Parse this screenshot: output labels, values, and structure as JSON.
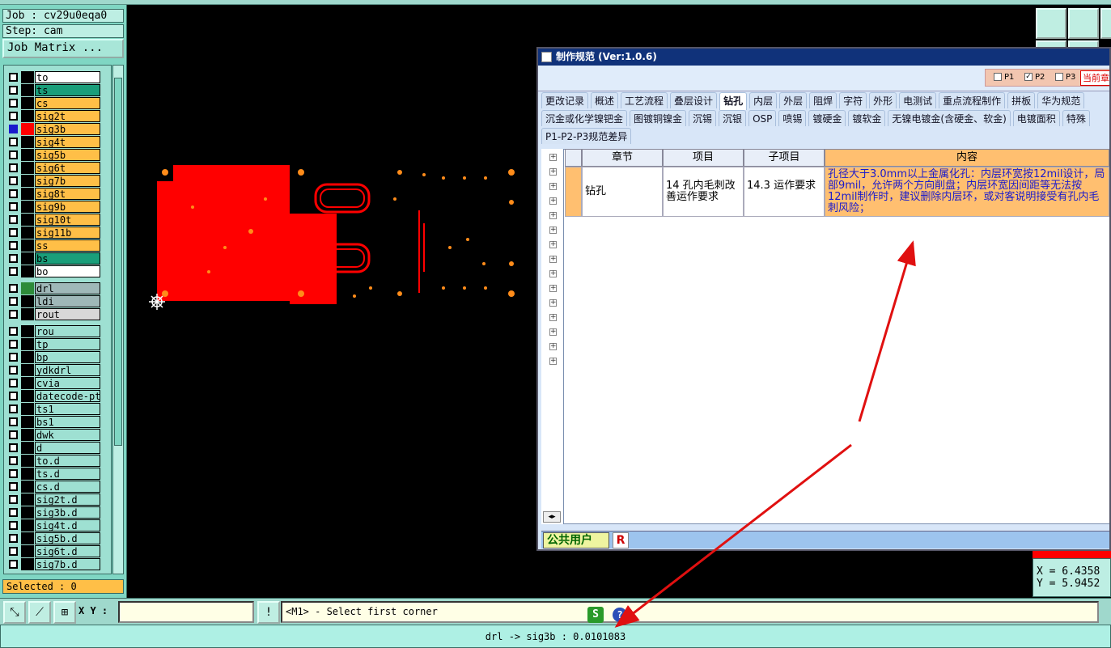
{
  "app": {
    "job_label": "Job : cv29u0eqa0",
    "step_label": "Step: cam",
    "job_matrix_button": "Job Matrix ...",
    "selected_label": "Selected : 0"
  },
  "layers": [
    {
      "name": "to",
      "bg": "#ffffff",
      "sw": "#000000"
    },
    {
      "name": "ts",
      "bg": "#1a9e7a",
      "sw": "#000000"
    },
    {
      "name": "cs",
      "bg": "#ffbf47",
      "sw": "#000000"
    },
    {
      "name": "sig2t",
      "bg": "#ffbf47",
      "sw": "#000000"
    },
    {
      "name": "sig3b",
      "bg": "#ffbf47",
      "sw": "#ff0000",
      "active": true
    },
    {
      "name": "sig4t",
      "bg": "#ffbf47",
      "sw": "#000000"
    },
    {
      "name": "sig5b",
      "bg": "#ffbf47",
      "sw": "#000000"
    },
    {
      "name": "sig6t",
      "bg": "#ffbf47",
      "sw": "#000000"
    },
    {
      "name": "sig7b",
      "bg": "#ffbf47",
      "sw": "#000000"
    },
    {
      "name": "sig8t",
      "bg": "#ffbf47",
      "sw": "#000000"
    },
    {
      "name": "sig9b",
      "bg": "#ffbf47",
      "sw": "#000000"
    },
    {
      "name": "sig10t",
      "bg": "#ffbf47",
      "sw": "#000000"
    },
    {
      "name": "sig11b",
      "bg": "#ffbf47",
      "sw": "#000000"
    },
    {
      "name": "ss",
      "bg": "#ffbf47",
      "sw": "#000000"
    },
    {
      "name": "bs",
      "bg": "#1a9e7a",
      "sw": "#000000"
    },
    {
      "name": "bo",
      "bg": "#ffffff",
      "sw": "#000000"
    },
    {
      "name": "drl",
      "bg": "#9fb8b8",
      "sw": "#2e8b3a"
    },
    {
      "name": "ldi",
      "bg": "#9fb8b8",
      "sw": "#000000"
    },
    {
      "name": "rout",
      "bg": "#d8d8d8",
      "sw": "#000000"
    },
    {
      "name": "rou",
      "bg": "#9ee0d2",
      "sw": "#000000"
    },
    {
      "name": "tp",
      "bg": "#9ee0d2",
      "sw": "#000000"
    },
    {
      "name": "bp",
      "bg": "#9ee0d2",
      "sw": "#000000"
    },
    {
      "name": "ydkdrl",
      "bg": "#9ee0d2",
      "sw": "#000000"
    },
    {
      "name": "cvia",
      "bg": "#9ee0d2",
      "sw": "#000000"
    },
    {
      "name": "datecode-ptc",
      "bg": "#9ee0d2",
      "sw": "#000000"
    },
    {
      "name": "ts1",
      "bg": "#9ee0d2",
      "sw": "#000000"
    },
    {
      "name": "bs1",
      "bg": "#9ee0d2",
      "sw": "#000000"
    },
    {
      "name": "dwk",
      "bg": "#9ee0d2",
      "sw": "#000000"
    },
    {
      "name": "d",
      "bg": "#9ee0d2",
      "sw": "#000000"
    },
    {
      "name": "to.d",
      "bg": "#9ee0d2",
      "sw": "#000000"
    },
    {
      "name": "ts.d",
      "bg": "#9ee0d2",
      "sw": "#000000"
    },
    {
      "name": "cs.d",
      "bg": "#9ee0d2",
      "sw": "#000000"
    },
    {
      "name": "sig2t.d",
      "bg": "#9ee0d2",
      "sw": "#000000"
    },
    {
      "name": "sig3b.d",
      "bg": "#9ee0d2",
      "sw": "#000000"
    },
    {
      "name": "sig4t.d",
      "bg": "#9ee0d2",
      "sw": "#000000"
    },
    {
      "name": "sig5b.d",
      "bg": "#9ee0d2",
      "sw": "#000000"
    },
    {
      "name": "sig6t.d",
      "bg": "#9ee0d2",
      "sw": "#000000"
    },
    {
      "name": "sig7b.d",
      "bg": "#9ee0d2",
      "sw": "#000000"
    }
  ],
  "bottom": {
    "xy_label": "X Y :",
    "xy_value": "",
    "message": "<M1> - Select first corner",
    "status": "drl -> sig3b : 0.0101083"
  },
  "coords": {
    "x": "X  =  6.4358",
    "y": "Y  =  5.9452"
  },
  "dialog": {
    "title": "制作规范 (Ver:1.0.6)",
    "p_tabs": [
      "P1",
      "P2",
      "P3"
    ],
    "current_chapter": "当前章",
    "tabs_row1": [
      "更改记录",
      "概述",
      "工艺流程",
      "叠层设计",
      "钻孔",
      "内层",
      "外层",
      "阻焊",
      "字符",
      "外形",
      "电测试",
      "重点流程制作",
      "拼板",
      "华为规范"
    ],
    "tabs_row2": [
      "沉金或化学镍钯金",
      "图镀铜镍金",
      "沉锡",
      "沉银",
      "OSP",
      "喷锡",
      "镀硬金",
      "镀软金",
      "无镍电镀金(含硬金、软金)",
      "电镀面积",
      "特殊"
    ],
    "tabs_row3": [
      "P1-P2-P3规范差异"
    ],
    "active_tab": "钻孔",
    "columns": [
      "章节",
      "项目",
      "子项目",
      "内容"
    ],
    "row": {
      "chapter": "钻孔",
      "item": "14 孔内毛刺改善运作要求",
      "subitem": "14.3 运作要求",
      "content": "孔径大于3.0mm以上金属化孔：内层环宽按12mil设计，局部9mil，允许两个方向削盘；内层环宽因间距等无法按12mil制作时，建议删除内层环，或对客说明接受有孔内毛刺风险；"
    },
    "user": "公共用户",
    "user_badge": "R"
  },
  "colors": {
    "accent_panel": "#7fd6c3",
    "layer_active": "#ff0000",
    "arrow": "#e01010",
    "dialog_title": "#10327a"
  }
}
